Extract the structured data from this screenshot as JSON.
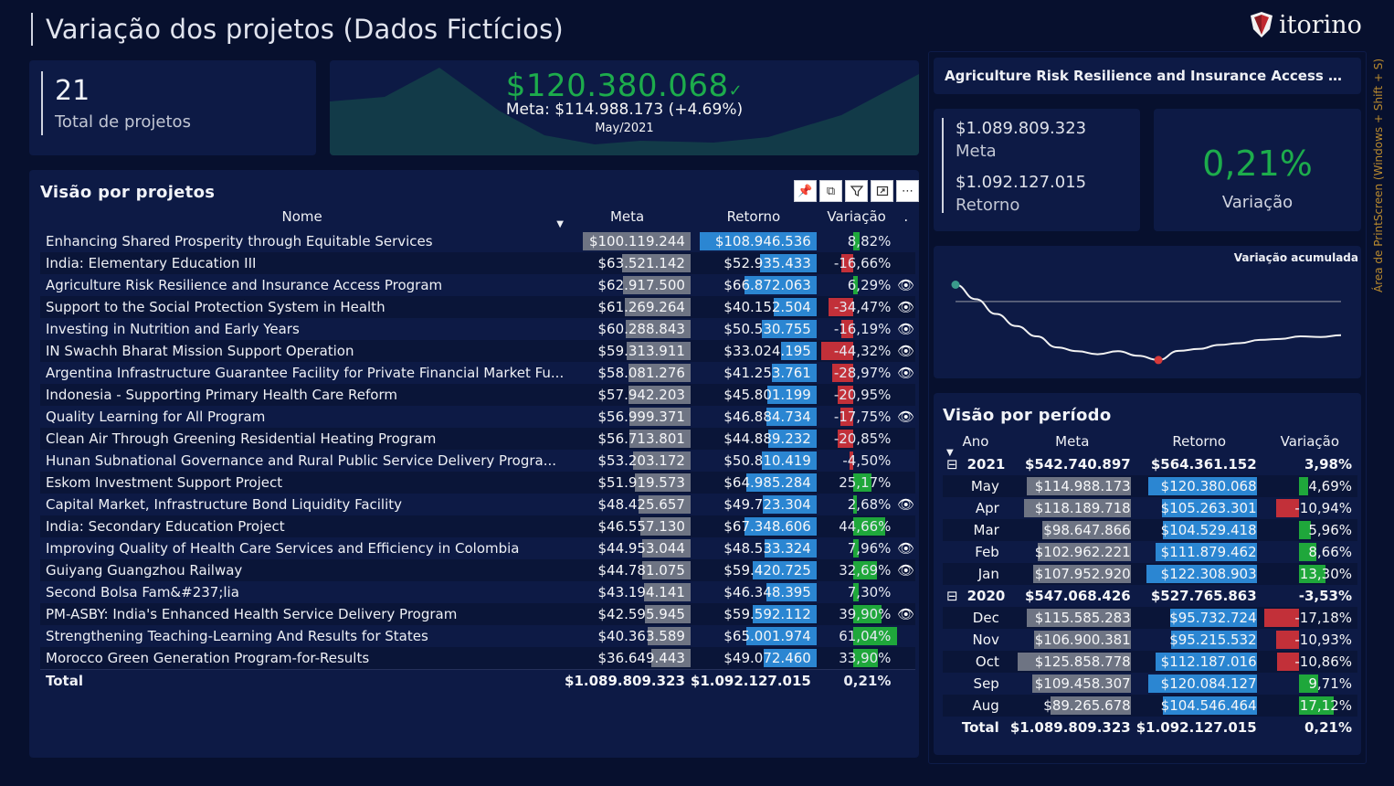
{
  "header": {
    "title": "Variação dos projetos (Dados Fictícios)",
    "logo_text": "itorino"
  },
  "colors": {
    "background": "#07102e",
    "card": "#0d1a45",
    "positive": "#1fa73b",
    "negative": "#c23039",
    "meta_bar": "#6e7483",
    "return_bar": "#2b86d2",
    "kpi_green": "#1dac4c"
  },
  "kpi_count": {
    "value": "21",
    "label": "Total de projetos"
  },
  "kpi_main": {
    "value": "$120.380.068",
    "check": "✓",
    "meta": "Meta: $114.988.173 (+4.69%)",
    "date": "May/2021"
  },
  "projects": {
    "title": "Visão por projetos",
    "toolbar": [
      "pin-icon",
      "copy-icon",
      "filter-icon",
      "focus-icon",
      "more-icon"
    ],
    "columns": {
      "name": "Nome",
      "meta": "Meta",
      "retorno": "Retorno",
      "variacao": "Variação",
      "extra": "."
    },
    "max_value": 108946536,
    "rows": [
      {
        "name": "Enhancing Shared Prosperity through Equitable Services",
        "meta": "$100.119.244",
        "meta_v": 100119244,
        "ret": "$108.946.536",
        "ret_v": 108946536,
        "var": "8,82%",
        "var_v": 8.82,
        "eye": false
      },
      {
        "name": "India:  Elementary Education III",
        "meta": "$63.521.142",
        "meta_v": 63521142,
        "ret": "$52.935.433",
        "ret_v": 52935433,
        "var": "-16,66%",
        "var_v": -16.66,
        "eye": false
      },
      {
        "name": "Agriculture Risk Resilience and Insurance Access Program",
        "meta": "$62.917.500",
        "meta_v": 62917500,
        "ret": "$66.872.063",
        "ret_v": 66872063,
        "var": "6,29%",
        "var_v": 6.29,
        "eye": true
      },
      {
        "name": "Support to the Social Protection System in Health",
        "meta": "$61.269.264",
        "meta_v": 61269264,
        "ret": "$40.152.504",
        "ret_v": 40152504,
        "var": "-34,47%",
        "var_v": -34.47,
        "eye": true
      },
      {
        "name": "Investing in Nutrition and Early Years",
        "meta": "$60.288.843",
        "meta_v": 60288843,
        "ret": "$50.530.755",
        "ret_v": 50530755,
        "var": "-16,19%",
        "var_v": -16.19,
        "eye": true
      },
      {
        "name": "IN Swachh Bharat Mission Support Operation",
        "meta": "$59.313.911",
        "meta_v": 59313911,
        "ret": "$33.024.195",
        "ret_v": 33024195,
        "var": "-44,32%",
        "var_v": -44.32,
        "eye": true
      },
      {
        "name": "Argentina Infrastructure Guarantee Facility for Private Financial Market Fu...",
        "meta": "$58.081.276",
        "meta_v": 58081276,
        "ret": "$41.253.761",
        "ret_v": 41253761,
        "var": "-28,97%",
        "var_v": -28.97,
        "eye": true
      },
      {
        "name": "Indonesia - Supporting Primary Health Care Reform",
        "meta": "$57.942.203",
        "meta_v": 57942203,
        "ret": "$45.801.199",
        "ret_v": 45801199,
        "var": "-20,95%",
        "var_v": -20.95,
        "eye": false
      },
      {
        "name": "Quality Learning for All Program",
        "meta": "$56.999.371",
        "meta_v": 56999371,
        "ret": "$46.884.734",
        "ret_v": 46884734,
        "var": "-17,75%",
        "var_v": -17.75,
        "eye": true
      },
      {
        "name": "Clean Air Through Greening Residential Heating Program",
        "meta": "$56.713.801",
        "meta_v": 56713801,
        "ret": "$44.889.232",
        "ret_v": 44889232,
        "var": "-20,85%",
        "var_v": -20.85,
        "eye": false
      },
      {
        "name": "Hunan Subnational Governance and Rural Public Service Delivery Progra...",
        "meta": "$53.203.172",
        "meta_v": 53203172,
        "ret": "$50.810.419",
        "ret_v": 50810419,
        "var": "-4,50%",
        "var_v": -4.5,
        "eye": false
      },
      {
        "name": "Eskom Investment Support Project",
        "meta": "$51.919.573",
        "meta_v": 51919573,
        "ret": "$64.985.284",
        "ret_v": 64985284,
        "var": "25,17%",
        "var_v": 25.17,
        "eye": false
      },
      {
        "name": "Capital Market, Infrastructure Bond Liquidity Facility",
        "meta": "$48.425.657",
        "meta_v": 48425657,
        "ret": "$49.723.304",
        "ret_v": 49723304,
        "var": "2,68%",
        "var_v": 2.68,
        "eye": true
      },
      {
        "name": "India: Secondary Education Project",
        "meta": "$46.557.130",
        "meta_v": 46557130,
        "ret": "$67.348.606",
        "ret_v": 67348606,
        "var": "44,66%",
        "var_v": 44.66,
        "eye": false
      },
      {
        "name": "Improving Quality of Health Care Services and Efficiency in Colombia",
        "meta": "$44.953.044",
        "meta_v": 44953044,
        "ret": "$48.533.324",
        "ret_v": 48533324,
        "var": "7,96%",
        "var_v": 7.96,
        "eye": true
      },
      {
        "name": "Guiyang Guangzhou Railway",
        "meta": "$44.781.075",
        "meta_v": 44781075,
        "ret": "$59.420.725",
        "ret_v": 59420725,
        "var": "32,69%",
        "var_v": 32.69,
        "eye": true
      },
      {
        "name": "Second Bolsa Fam&#237;lia",
        "meta": "$43.194.141",
        "meta_v": 43194141,
        "ret": "$46.348.395",
        "ret_v": 46348395,
        "var": "7,30%",
        "var_v": 7.3,
        "eye": false
      },
      {
        "name": "PM-ASBY: India's Enhanced Health Service Delivery Program",
        "meta": "$42.595.945",
        "meta_v": 42595945,
        "ret": "$59.592.112",
        "ret_v": 59592112,
        "var": "39,90%",
        "var_v": 39.9,
        "eye": true
      },
      {
        "name": "Strengthening Teaching-Learning  And Results for States",
        "meta": "$40.363.589",
        "meta_v": 40363589,
        "ret": "$65.001.974",
        "ret_v": 65001974,
        "var": "61,04%",
        "var_v": 61.04,
        "eye": false
      },
      {
        "name": "Morocco Green Generation Program-for-Results",
        "meta": "$36.649.443",
        "meta_v": 36649443,
        "ret": "$49.072.460",
        "ret_v": 49072460,
        "var": "33,90%",
        "var_v": 33.9,
        "eye": false
      }
    ],
    "total": {
      "label": "Total",
      "meta": "$1.089.809.323",
      "ret": "$1.092.127.015",
      "var": "0,21%"
    }
  },
  "selected_project": {
    "title": "Agriculture Risk Resilience and Insurance Access Progr...",
    "meta_value": "$1.089.809.323",
    "meta_label": "Meta",
    "ret_value": "$1.092.127.015",
    "ret_label": "Retorno",
    "var_value": "0,21%",
    "var_label": "Variação"
  },
  "line_chart": {
    "title": "Variação acumulada"
  },
  "chart_data": {
    "type": "line",
    "title": "Variação acumulada",
    "series": [
      {
        "values": [
          8.82,
          1.2,
          -6.5,
          -12.8,
          -18.2,
          -24.0,
          -26.0,
          -27.6,
          -26.0,
          -28.4,
          -30.6,
          -25.8,
          -24.8,
          -22.7,
          -21.8,
          -20.1,
          -19.6,
          -18.2,
          -18.6,
          -17.6
        ]
      }
    ],
    "min_marker_index": 10,
    "baseline": 0
  },
  "period": {
    "title": "Visão por período",
    "columns": {
      "ano": "Ano",
      "meta": "Meta",
      "retorno": "Retorno",
      "variacao": "Variação"
    },
    "max_value": 125858778,
    "rows": [
      {
        "kind": "year",
        "label": "2021",
        "toggle": "⊟",
        "meta": "$542.740.897",
        "ret": "$564.361.152",
        "var": "3,98%"
      },
      {
        "kind": "month",
        "label": "May",
        "meta": "$114.988.173",
        "meta_v": 114988173,
        "ret": "$120.380.068",
        "ret_v": 120380068,
        "var": "4,69%",
        "var_v": 4.69
      },
      {
        "kind": "month",
        "label": "Apr",
        "meta": "$118.189.718",
        "meta_v": 118189718,
        "ret": "$105.263.301",
        "ret_v": 105263301,
        "var": "-10,94%",
        "var_v": -10.94
      },
      {
        "kind": "month",
        "label": "Mar",
        "meta": "$98.647.866",
        "meta_v": 98647866,
        "ret": "$104.529.418",
        "ret_v": 104529418,
        "var": "5,96%",
        "var_v": 5.96
      },
      {
        "kind": "month",
        "label": "Feb",
        "meta": "$102.962.221",
        "meta_v": 102962221,
        "ret": "$111.879.462",
        "ret_v": 111879462,
        "var": "8,66%",
        "var_v": 8.66
      },
      {
        "kind": "month",
        "label": "Jan",
        "meta": "$107.952.920",
        "meta_v": 107952920,
        "ret": "$122.308.903",
        "ret_v": 122308903,
        "var": "13,30%",
        "var_v": 13.3
      },
      {
        "kind": "year",
        "label": "2020",
        "toggle": "⊟",
        "meta": "$547.068.426",
        "ret": "$527.765.863",
        "var": "-3,53%"
      },
      {
        "kind": "month",
        "label": "Dec",
        "meta": "$115.585.283",
        "meta_v": 115585283,
        "ret": "$95.732.724",
        "ret_v": 95732724,
        "var": "-17,18%",
        "var_v": -17.18
      },
      {
        "kind": "month",
        "label": "Nov",
        "meta": "$106.900.381",
        "meta_v": 106900381,
        "ret": "$95.215.532",
        "ret_v": 95215532,
        "var": "-10,93%",
        "var_v": -10.93
      },
      {
        "kind": "month",
        "label": "Oct",
        "meta": "$125.858.778",
        "meta_v": 125858778,
        "ret": "$112.187.016",
        "ret_v": 112187016,
        "var": "-10,86%",
        "var_v": -10.86
      },
      {
        "kind": "month",
        "label": "Sep",
        "meta": "$109.458.307",
        "meta_v": 109458307,
        "ret": "$120.084.127",
        "ret_v": 120084127,
        "var": "9,71%",
        "var_v": 9.71
      },
      {
        "kind": "month",
        "label": "Aug",
        "meta": "$89.265.678",
        "meta_v": 89265678,
        "ret": "$104.546.464",
        "ret_v": 104546464,
        "var": "17,12%",
        "var_v": 17.12
      }
    ],
    "total": {
      "label": "Total",
      "meta": "$1.089.809.323",
      "ret": "$1.092.127.015",
      "var": "0,21%"
    }
  },
  "side_text": "Área de PrintScreen (Windows + Shift + S)"
}
